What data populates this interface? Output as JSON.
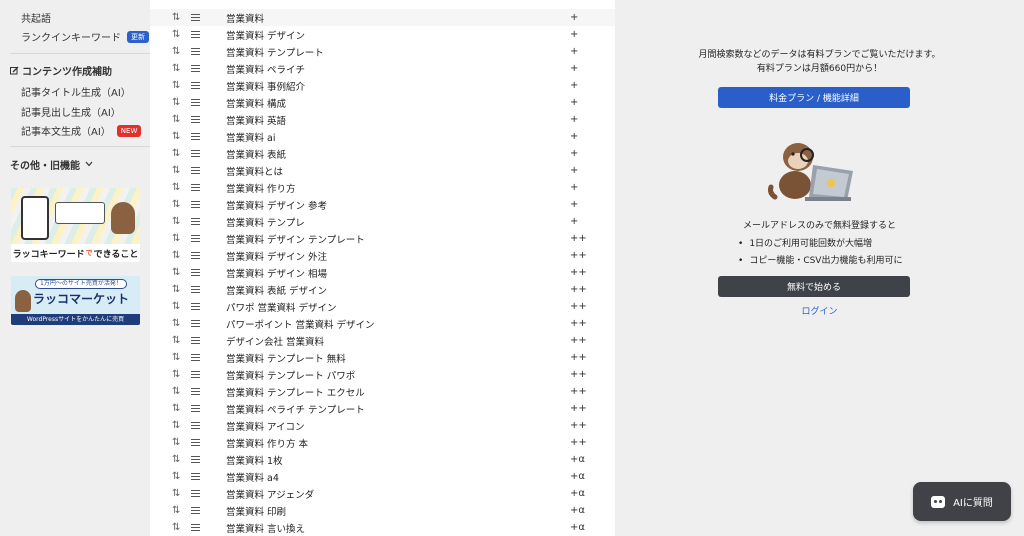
{
  "sidebar": {
    "cooccurrence": "共起語",
    "rankin": "ランクインキーワード",
    "rankin_badge": "更新",
    "content_head": "コンテンツ作成補助",
    "title_gen": "記事タイトル生成（AI）",
    "heading_gen": "記事見出し生成（AI）",
    "body_gen": "記事本文生成（AI）",
    "body_badge": "NEW",
    "other_head": "その他・旧機能",
    "banner1_text_a": "ラッコキーワード",
    "banner1_text_b": "で",
    "banner1_text_c": "できること",
    "banner2_pill": "1万円〜のサイト売買が活発！",
    "banner2_title": "ラッコマーケット",
    "banner2_sub": "WordPressサイトをかんたんに売買"
  },
  "keywords": [
    {
      "kw": "営業資料",
      "mark": "+"
    },
    {
      "kw": "営業資料 デザイン",
      "mark": "+"
    },
    {
      "kw": "営業資料 テンプレート",
      "mark": "+"
    },
    {
      "kw": "営業資料 ペライチ",
      "mark": "+"
    },
    {
      "kw": "営業資料 事例紹介",
      "mark": "+"
    },
    {
      "kw": "営業資料 構成",
      "mark": "+"
    },
    {
      "kw": "営業資料 英語",
      "mark": "+"
    },
    {
      "kw": "営業資料 ai",
      "mark": "+"
    },
    {
      "kw": "営業資料 表紙",
      "mark": "+"
    },
    {
      "kw": "営業資料とは",
      "mark": "+"
    },
    {
      "kw": "営業資料 作り方",
      "mark": "+"
    },
    {
      "kw": "営業資料 デザイン 参考",
      "mark": "+"
    },
    {
      "kw": "営業資料 テンプレ",
      "mark": "+"
    },
    {
      "kw": "営業資料 デザイン テンプレート",
      "mark": "++"
    },
    {
      "kw": "営業資料 デザイン 外注",
      "mark": "++"
    },
    {
      "kw": "営業資料 デザイン 相場",
      "mark": "++"
    },
    {
      "kw": "営業資料 表紙 デザイン",
      "mark": "++"
    },
    {
      "kw": "パワポ 営業資料 デザイン",
      "mark": "++"
    },
    {
      "kw": "パワーポイント 営業資料 デザイン",
      "mark": "++"
    },
    {
      "kw": "デザイン会社 営業資料",
      "mark": "++"
    },
    {
      "kw": "営業資料 テンプレート 無料",
      "mark": "++"
    },
    {
      "kw": "営業資料 テンプレート パワポ",
      "mark": "++"
    },
    {
      "kw": "営業資料 テンプレート エクセル",
      "mark": "++"
    },
    {
      "kw": "営業資料 ペライチ テンプレート",
      "mark": "++"
    },
    {
      "kw": "営業資料 アイコン",
      "mark": "++"
    },
    {
      "kw": "営業資料 作り方 本",
      "mark": "++"
    },
    {
      "kw": "営業資料 1枚",
      "mark": "+α"
    },
    {
      "kw": "営業資料 a4",
      "mark": "+α"
    },
    {
      "kw": "営業資料 アジェンダ",
      "mark": "+α"
    },
    {
      "kw": "営業資料 印刷",
      "mark": "+α"
    },
    {
      "kw": "営業資料 言い換え",
      "mark": "+α"
    }
  ],
  "panel": {
    "line1": "月間検索数などのデータは有料プランでご覧いただけます。",
    "line2": "有料プランは月額660円から！",
    "plan_button": "料金プラン / 機能詳細",
    "register_text": "メールアドレスのみで無料登録すると",
    "bullet1": "1日のご利用可能回数が大幅増",
    "bullet2": "コピー機能・CSV出力機能も利用可に",
    "start_button": "無料で始める",
    "login": "ログイン"
  },
  "ai_button": "AIに質問",
  "colors": {
    "accent": "#2a5fc9",
    "dark_button": "#3f4248",
    "new_badge": "#e0312c"
  }
}
